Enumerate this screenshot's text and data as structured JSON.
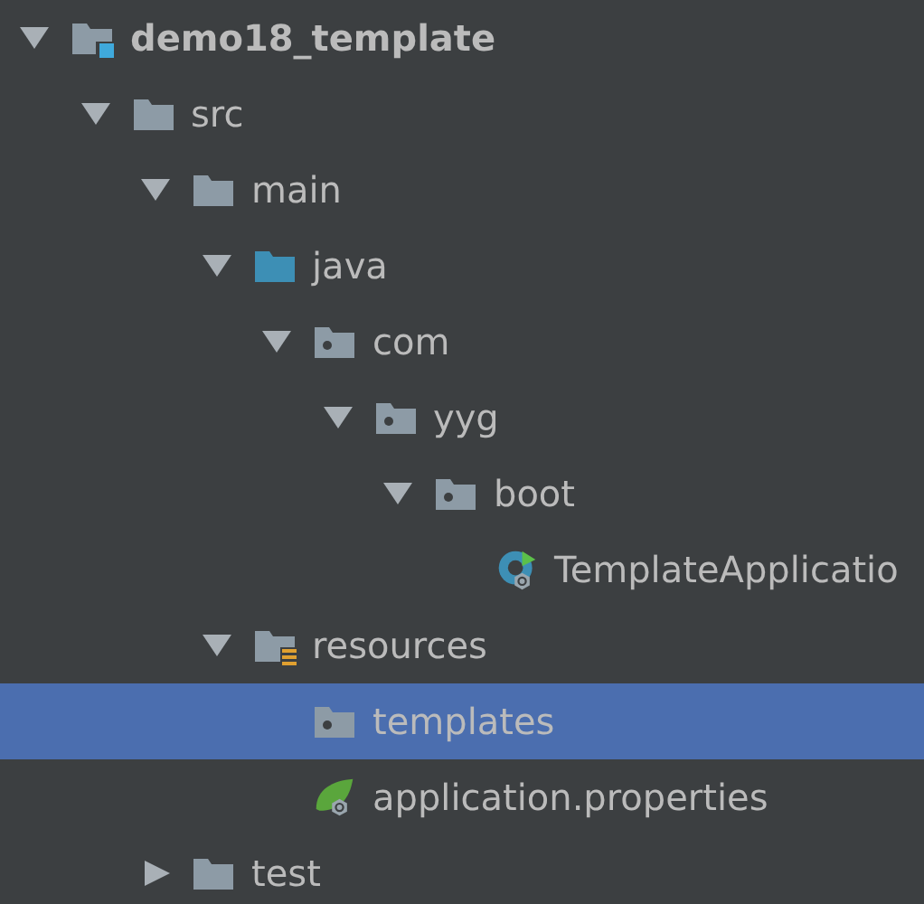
{
  "project_tree": [
    {
      "label": "demo18_template",
      "kind": "module",
      "expanded": true,
      "selected": false,
      "children": [
        {
          "label": "src",
          "kind": "folder",
          "expanded": true,
          "selected": false,
          "children": [
            {
              "label": "main",
              "kind": "folder",
              "expanded": true,
              "selected": false,
              "children": [
                {
                  "label": "java",
                  "kind": "source-folder",
                  "expanded": true,
                  "selected": false,
                  "children": [
                    {
                      "label": "com",
                      "kind": "package",
                      "expanded": true,
                      "selected": false,
                      "children": [
                        {
                          "label": "yyg",
                          "kind": "package",
                          "expanded": true,
                          "selected": false,
                          "children": [
                            {
                              "label": "boot",
                              "kind": "package",
                              "expanded": true,
                              "selected": false,
                              "children": [
                                {
                                  "label": "TemplateApplicatio",
                                  "kind": "spring-class",
                                  "selected": false
                                }
                              ]
                            }
                          ]
                        }
                      ]
                    }
                  ]
                },
                {
                  "label": "resources",
                  "kind": "resources-folder",
                  "expanded": true,
                  "selected": false,
                  "children": [
                    {
                      "label": "templates",
                      "kind": "package",
                      "selected": true
                    },
                    {
                      "label": "application.properties",
                      "kind": "spring-properties",
                      "selected": false
                    }
                  ]
                }
              ]
            },
            {
              "label": "test",
              "kind": "folder",
              "expanded": false,
              "selected": false
            }
          ]
        }
      ]
    }
  ]
}
